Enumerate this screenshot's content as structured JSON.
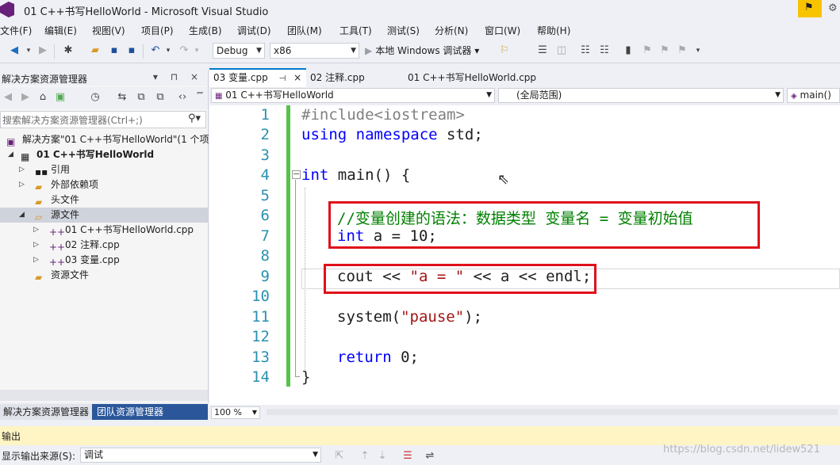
{
  "window": {
    "title": "01 C++书写HelloWorld - Microsoft Visual Studio"
  },
  "menu": [
    "文件(F)",
    "编辑(E)",
    "视图(V)",
    "项目(P)",
    "生成(B)",
    "调试(D)",
    "团队(M)",
    "工具(T)",
    "测试(S)",
    "分析(N)",
    "窗口(W)",
    "帮助(H)"
  ],
  "toolbar": {
    "config": "Debug",
    "platform": "x86",
    "run_label": "本地 Windows 调试器"
  },
  "solution_explorer": {
    "title": "解决方案资源管理器",
    "search_placeholder": "搜索解决方案资源管理器(Ctrl+;)",
    "tree": {
      "solution": "解决方案\"01 C++书写HelloWorld\"(1 个项",
      "project": "01 C++书写HelloWorld",
      "references": "引用",
      "external": "外部依赖项",
      "headers": "头文件",
      "sources": "源文件",
      "file1": "01 C++书写HelloWorld.cpp",
      "file2": "02 注释.cpp",
      "file3": "03 变量.cpp",
      "resources": "资源文件"
    },
    "tab_active": "解决方案资源管理器",
    "tab_team": "团队资源管理器"
  },
  "editor": {
    "tabs": {
      "t1": "03 变量.cpp",
      "t2": "02 注释.cpp",
      "t3": "01 C++书写HelloWorld.cpp"
    },
    "nav": {
      "project": "01 C++书写HelloWorld",
      "scope": "(全局范围)",
      "member": "main()"
    },
    "line_numbers": [
      "1",
      "2",
      "3",
      "4",
      "5",
      "6",
      "7",
      "8",
      "9",
      "10",
      "11",
      "12",
      "13",
      "14"
    ],
    "code": {
      "l1": "#include<iostream>",
      "l2_kw1": "using",
      "l2_kw2": "namespace",
      "l2_rest": " std;",
      "l4_kw": "int",
      "l4_rest": " main() {",
      "l6": "//变量创建的语法：数据类型 变量名 = 变量初始值",
      "l7_kw": "int",
      "l7_rest": " a = 10;",
      "l9_a": "cout << ",
      "l9_str": "\"a = \"",
      "l9_b": " << a << endl;",
      "l11_a": "system(",
      "l11_str": "\"pause\"",
      "l11_b": ");",
      "l13_kw": "return",
      "l13_rest": " 0;",
      "l14": "}"
    },
    "zoom": "100 %"
  },
  "output": {
    "title": "输出",
    "source_label": "显示输出来源(S):",
    "source_value": "调试"
  },
  "watermark": "https://blog.csdn.net/lidew521"
}
